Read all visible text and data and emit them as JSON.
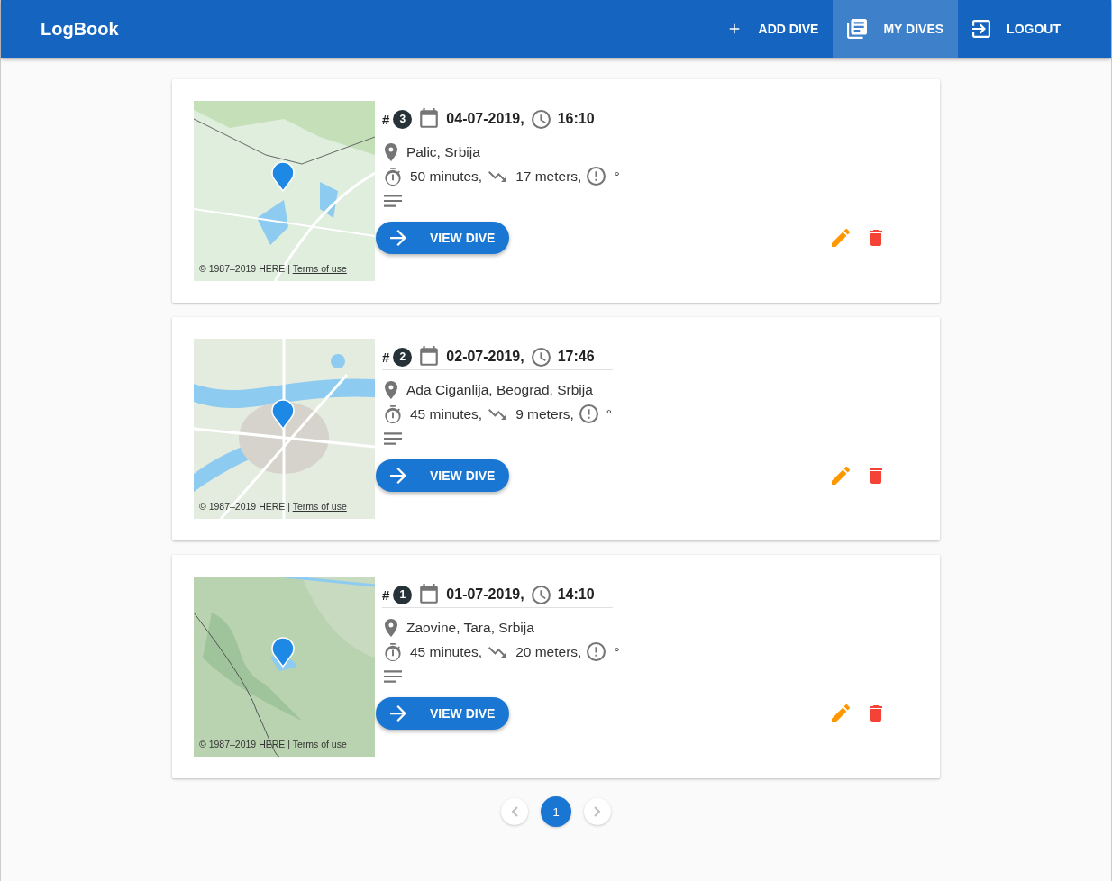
{
  "app_bar": {
    "title": "LogBook",
    "nav": [
      {
        "label": "ADD DIVE",
        "kind": "plus",
        "selected": false
      },
      {
        "label": "MY DIVES",
        "kind": "list",
        "selected": true
      },
      {
        "label": "LOGOUT",
        "kind": "logout",
        "selected": false
      }
    ]
  },
  "dives": [
    {
      "hash": "#",
      "number": "3",
      "date": "04-07-2019,",
      "time": "16:10",
      "location": "Palic, Srbija",
      "duration": "50 minutes,",
      "depth": "17 meters,",
      "temperature": "°",
      "map": {
        "kind": "picture",
        "attribution": "© 1987–2019 HERE |",
        "terms_link": "Terms of use"
      },
      "button": "VIEW DIVE"
    },
    {
      "hash": "#",
      "number": "2",
      "date": "02-07-2019,",
      "time": "17:46",
      "location": "Ada Ciganlija, Beograd, Srbija",
      "duration": "45 minutes,",
      "depth": "9 meters,",
      "temperature": "°",
      "map": {
        "kind": "picture",
        "attribution": "© 1987–2019 HERE |",
        "terms_link": "Terms of use"
      },
      "button": "VIEW DIVE"
    },
    {
      "hash": "#",
      "number": "1",
      "date": "01-07-2019,",
      "time": "14:10",
      "location": "Zaovine, Tara, Srbija",
      "duration": "45 minutes,",
      "depth": "20 meters,",
      "temperature": "°",
      "map": {
        "kind": "picture",
        "attribution": "© 1987–2019 HERE |",
        "terms_link": "Terms of use"
      },
      "button": "VIEW DIVE"
    }
  ],
  "pagination": {
    "previous": {
      "disabled": true
    },
    "pages": [
      {
        "label": "1",
        "selected": true
      }
    ],
    "next": {
      "disabled": true
    }
  }
}
